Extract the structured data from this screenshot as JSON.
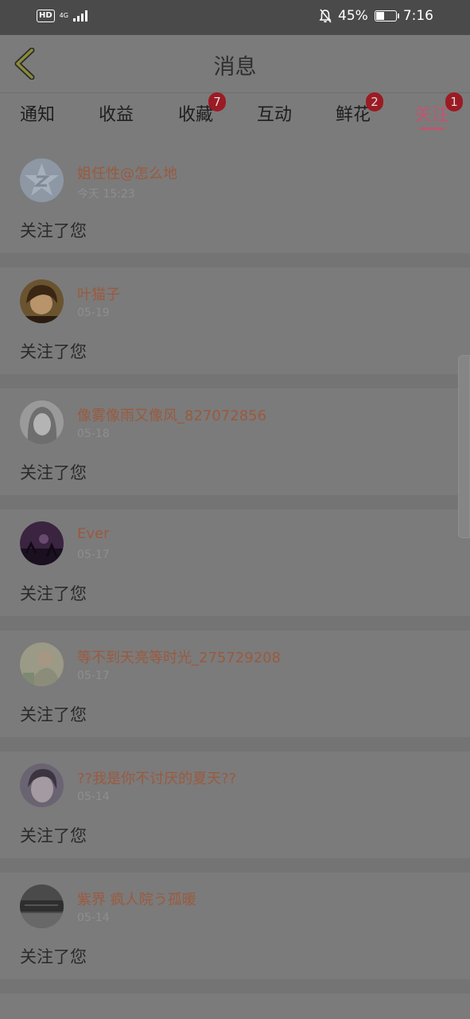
{
  "status_bar": {
    "hd": "HD",
    "network": "4G",
    "battery_percent": "45%",
    "battery_level": 0.45,
    "time": "7:16"
  },
  "header": {
    "title": "消息",
    "back_icon": "chevron-left-icon",
    "accent_color": "#c0566f"
  },
  "tabs": [
    {
      "label": "通知",
      "badge": ""
    },
    {
      "label": "收益",
      "badge": ""
    },
    {
      "label": "收藏",
      "badge": "7"
    },
    {
      "label": "互动",
      "badge": ""
    },
    {
      "label": "鲜花",
      "badge": "2"
    },
    {
      "label": "关注",
      "badge": "1",
      "active": true
    }
  ],
  "messages": [
    {
      "name": "姐任性@怎么地",
      "date": "今天 15:23",
      "action": "关注了您"
    },
    {
      "name": "叶猫子",
      "date": "05-19",
      "action": "关注了您"
    },
    {
      "name": "像雾像雨又像风_827072856",
      "date": "05-18",
      "action": "关注了您"
    },
    {
      "name": "Ever",
      "date": "05-17",
      "action": "关注了您"
    },
    {
      "name": "等不到天亮等时光_275729208",
      "date": "05-17",
      "action": "关注了您"
    },
    {
      "name": "??我是你不讨厌的夏天??",
      "date": "05-14",
      "action": "关注了您"
    },
    {
      "name": "紫界 疯人院う孤暖",
      "date": "05-14",
      "action": "关注了您"
    }
  ]
}
